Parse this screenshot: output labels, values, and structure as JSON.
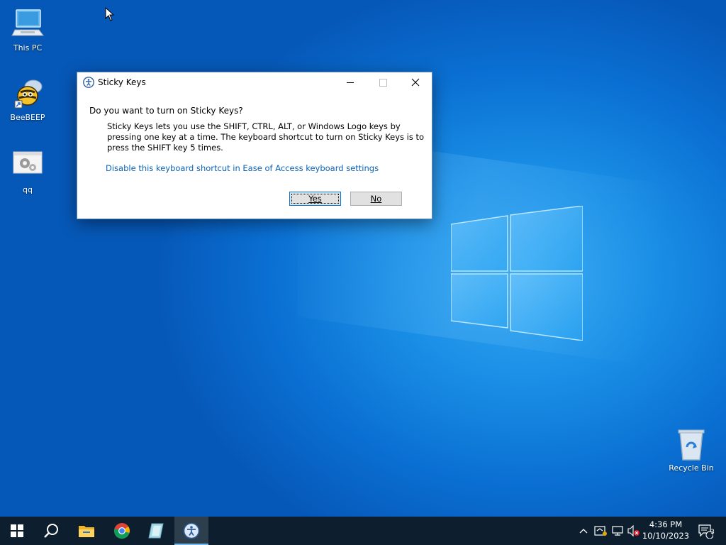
{
  "desktop": {
    "icons": [
      {
        "label": "This PC",
        "icon": "this-pc-icon"
      },
      {
        "label": "BeeBEEP",
        "icon": "beebeep-icon"
      },
      {
        "label": "qq",
        "icon": "settings-shortcut-icon"
      },
      {
        "label": "Recycle Bin",
        "icon": "recycle-bin-icon"
      }
    ]
  },
  "dialog": {
    "title": "Sticky Keys",
    "heading": "Do you want to turn on Sticky Keys?",
    "description": "Sticky Keys lets you use the SHIFT, CTRL, ALT, or Windows Logo keys by pressing one key at a time. The keyboard shortcut to turn on Sticky Keys is to press the SHIFT key 5 times.",
    "link": "Disable this keyboard shortcut in Ease of Access keyboard settings",
    "yes_label": "Yes",
    "no_label": "No"
  },
  "taskbar": {
    "items": [
      "start-icon",
      "search-icon",
      "file-explorer-icon",
      "chrome-icon",
      "app-icon",
      "sticky-keys-icon"
    ],
    "time": "4:36 PM",
    "date": "10/10/2023",
    "notification_count": "3"
  },
  "colors": {
    "accent": "#0078d7",
    "link": "#0b62b6",
    "taskbar": "#0d1f2e"
  }
}
